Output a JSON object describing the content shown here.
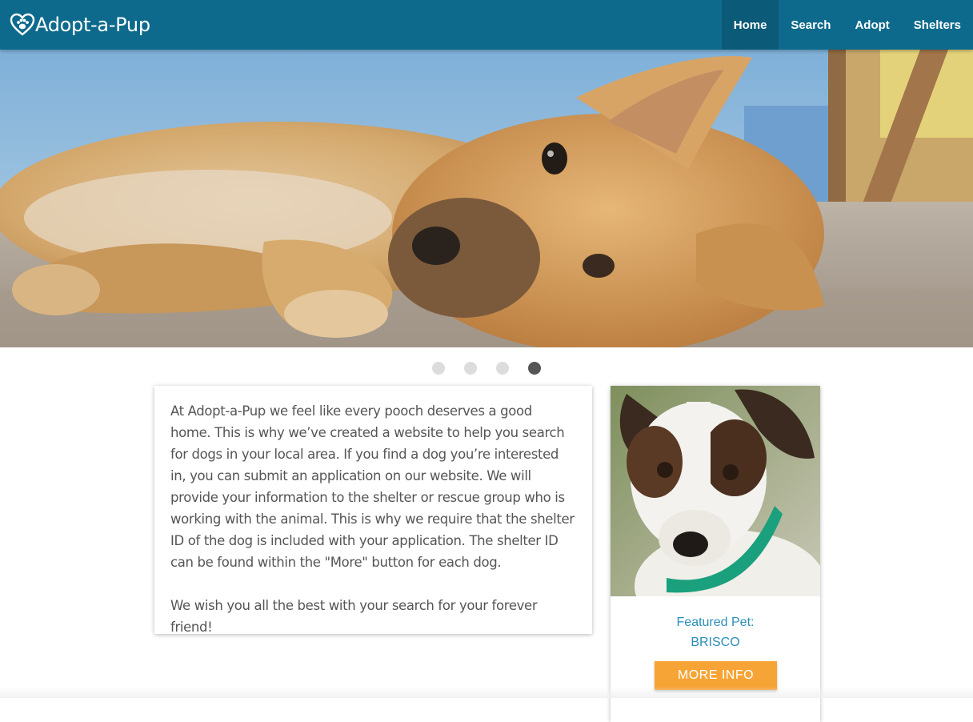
{
  "brand": {
    "name": "Adopt-a-Pup",
    "logo_icon": "heart-paw-icon"
  },
  "nav": {
    "items": [
      {
        "label": "Home",
        "active": true
      },
      {
        "label": "Search",
        "active": false
      },
      {
        "label": "Adopt",
        "active": false
      },
      {
        "label": "Shelters",
        "active": false
      }
    ]
  },
  "carousel": {
    "slide_count": 4,
    "active_index": 3
  },
  "intro": {
    "paragraph1": "At Adopt-a-Pup we feel like every pooch deserves a good home. This is why we’ve created a website to help you search for dogs in your local area. If you find a dog you’re interested in, you can submit an application on our website. We will provide your information to the shelter or rescue group who is working with the animal. This is why we require that the shelter ID of the dog is included with your application. The shelter ID can be found within the \"More\" button for each dog.",
    "paragraph2": "We wish you all the best with your search for your forever friend!"
  },
  "featured": {
    "label": "Featured Pet:",
    "name": "BRISCO",
    "button_label": "MORE INFO"
  },
  "colors": {
    "navbar": "#0e6a8c",
    "nav_active": "#0b5a77",
    "accent_text": "#2a8fb7",
    "button": "#f7a436"
  }
}
